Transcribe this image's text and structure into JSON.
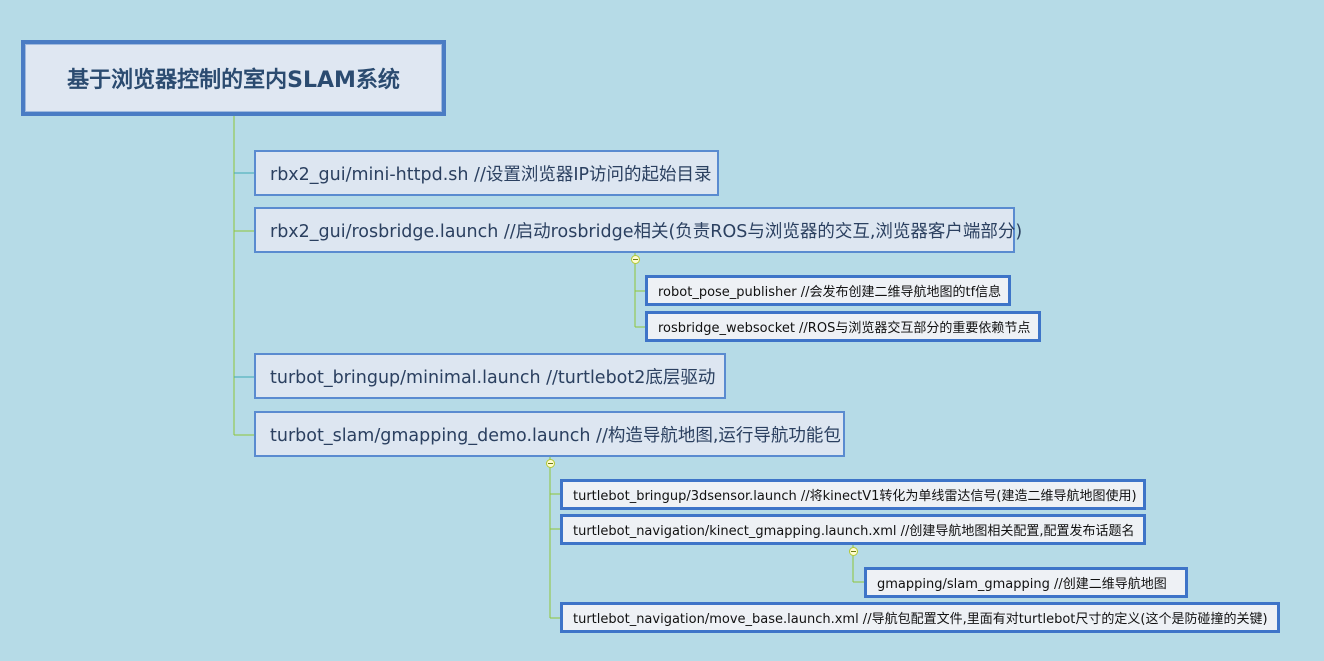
{
  "root": {
    "title": "基于浏览器控制的室内SLAM系统"
  },
  "nodes": {
    "mini_httpd": "rbx2_gui/mini-httpd.sh  //设置浏览器IP访问的起始目录",
    "rosbridge": "rbx2_gui/rosbridge.launch  //启动rosbridge相关(负责ROS与浏览器的交互,浏览器客户端部分)",
    "robot_pose_publisher": "robot_pose_publisher  //会发布创建二维导航地图的tf信息",
    "rosbridge_websocket": "rosbridge_websocket  //ROS与浏览器交互部分的重要依赖节点",
    "minimal": "turbot_bringup/minimal.launch  //turtlebot2底层驱动",
    "gmapping_demo": "turbot_slam/gmapping_demo.launch  //构造导航地图,运行导航功能包",
    "sensor": "turtlebot_bringup/3dsensor.launch   //将kinectV1转化为单线雷达信号(建造二维导航地图使用)",
    "kinect_gmapping": "turtlebot_navigation/kinect_gmapping.launch.xml  //创建导航地图相关配置,配置发布话题名",
    "slam_gmapping": "gmapping/slam_gmapping    //创建二维导航地图",
    "move_base": "turtlebot_navigation/move_base.launch.xml   //导航包配置文件,里面有对turtlebot尺寸的定义(这个是防碰撞的关键)"
  },
  "colors": {
    "background": "#b6dbe7",
    "root_border": "#4a7cc4",
    "node_border": "#3e74c8",
    "connector_green": "#8fc43a",
    "connector_teal": "#3fa9b5"
  }
}
